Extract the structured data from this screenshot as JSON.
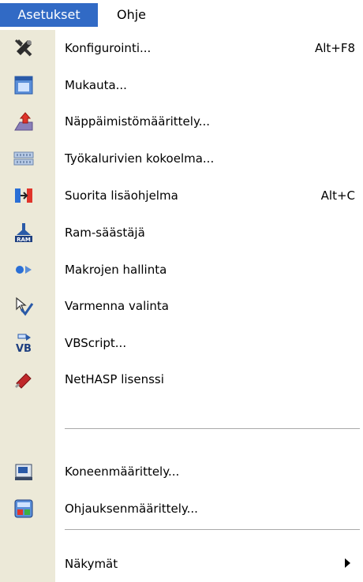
{
  "menubar": {
    "asetukset": "Asetukset",
    "ohje": "Ohje"
  },
  "menu": {
    "items": [
      {
        "label": "Konfigurointi...",
        "shortcut": "Alt+F8",
        "icon": "configure-icon"
      },
      {
        "label": "Mukauta...",
        "shortcut": "",
        "icon": "customize-icon"
      },
      {
        "label": "Näppäimistömäärittely...",
        "shortcut": "",
        "icon": "keyboard-definition-icon"
      },
      {
        "label": "Työkalurivien kokoelma...",
        "shortcut": "",
        "icon": "toolbars-icon"
      },
      {
        "label": "Suorita lisäohjelma",
        "shortcut": "Alt+C",
        "icon": "run-addon-icon"
      },
      {
        "label": "Ram-säästäjä",
        "shortcut": "",
        "icon": "ram-saver-icon"
      },
      {
        "label": "Makrojen hallinta",
        "shortcut": "",
        "icon": "macro-icon"
      },
      {
        "label": "Varmenna valinta",
        "shortcut": "",
        "icon": "verify-selection-icon"
      },
      {
        "label": "VBScript...",
        "shortcut": "",
        "icon": "vbscript-icon"
      },
      {
        "label": "NetHASP lisenssi",
        "shortcut": "",
        "icon": "usb-key-icon"
      },
      {
        "label": "Koneenmäärittely...",
        "shortcut": "",
        "icon": "machine-definition-icon"
      },
      {
        "label": "Ohjauksenmäärittely...",
        "shortcut": "",
        "icon": "control-definition-icon"
      },
      {
        "label": "Näkymät",
        "shortcut": "",
        "icon": "submenu-arrow-icon"
      }
    ]
  },
  "colors": {
    "highlight": "#316ac5",
    "gutter": "#ece9d8"
  }
}
